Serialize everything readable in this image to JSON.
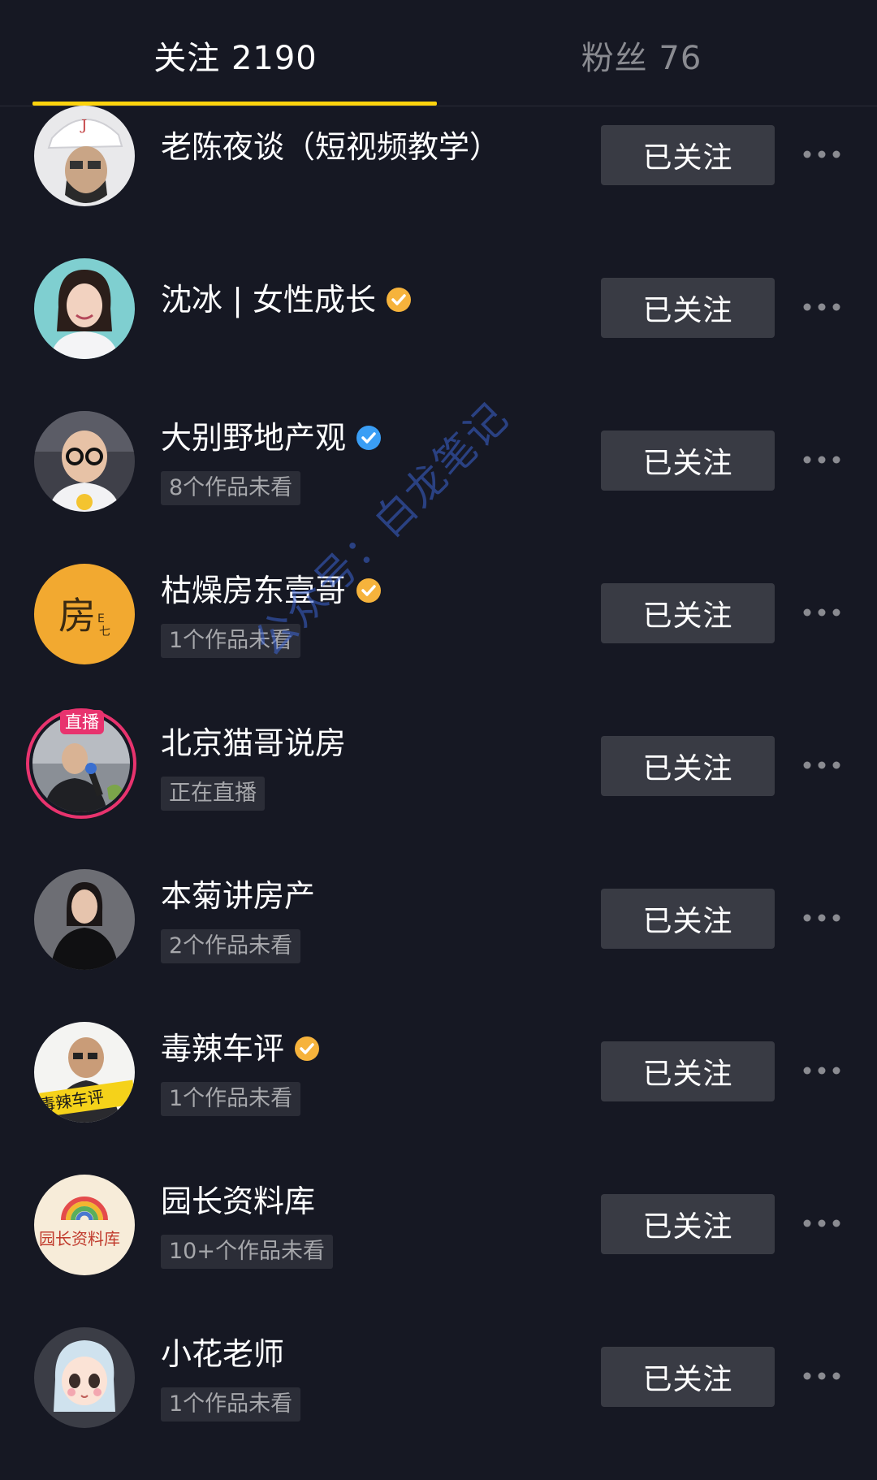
{
  "tabs": {
    "following": "关注 2190",
    "fans": "粉丝 76"
  },
  "follow_label": "已关注",
  "watermark": "公众号：白龙笔记",
  "colors": {
    "background": "#161823",
    "tab_underline": "#fdd30d",
    "button_bg": "#393b44",
    "badge_gold": "#f6b33c",
    "badge_blue": "#3a9ef5",
    "live": "#e8336e"
  },
  "users": [
    {
      "name": "老陈夜谈（短视频教学）",
      "badge": null,
      "sub": null,
      "live": false,
      "avatar": "man-white-cap"
    },
    {
      "name": "沈冰 | 女性成长",
      "badge": "gold",
      "sub": null,
      "live": false,
      "avatar": "woman-smiling"
    },
    {
      "name": "大别野地产观",
      "badge": "blue",
      "sub": "8个作品未看",
      "live": false,
      "avatar": "man-glasses"
    },
    {
      "name": "枯燥房东壹哥",
      "badge": "gold",
      "sub": "1个作品未看",
      "live": false,
      "avatar": "logo-fang"
    },
    {
      "name": "北京猫哥说房",
      "badge": null,
      "sub": "正在直播",
      "live": true,
      "live_label": "直播",
      "avatar": "man-microphone"
    },
    {
      "name": "本菊讲房产",
      "badge": null,
      "sub": "2个作品未看",
      "live": false,
      "avatar": "woman-black-suit"
    },
    {
      "name": "毒辣车评",
      "badge": "gold",
      "sub": "1个作品未看",
      "live": false,
      "avatar": "man-logo-dulacheping",
      "avatar_text": "毒辣车评"
    },
    {
      "name": "园长资料库",
      "badge": null,
      "sub": "10+个作品未看",
      "live": false,
      "avatar": "logo-rainbow",
      "avatar_text": "园长资料库"
    },
    {
      "name": "小花老师",
      "badge": null,
      "sub": "1个作品未看",
      "live": false,
      "avatar": "cartoon-girl"
    }
  ]
}
